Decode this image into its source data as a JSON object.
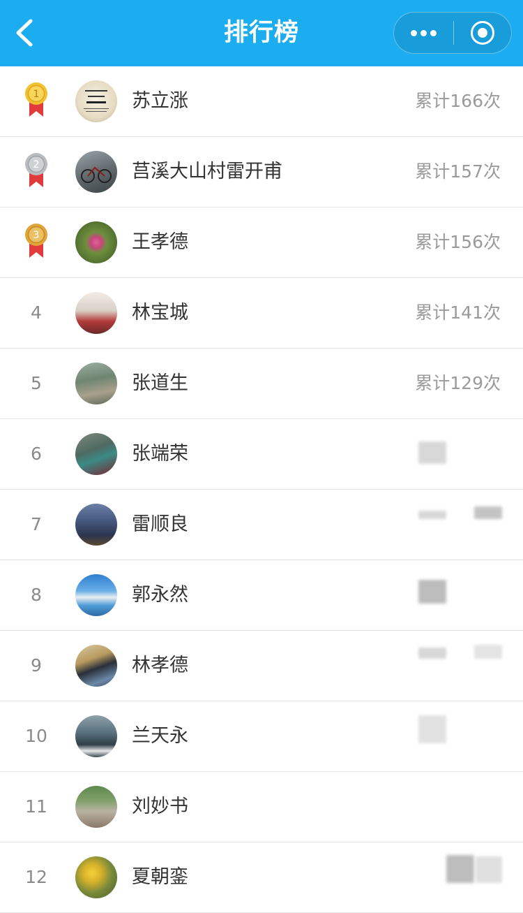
{
  "navbar": {
    "title": "排行榜",
    "back_icon": "chevron-left-icon",
    "more_icon": "more-dots-icon",
    "close_icon": "target-close-icon",
    "bg_color": "#1badf0"
  },
  "ranking": [
    {
      "rank": "1",
      "name": "苏立涨",
      "score": "累计166次",
      "medal": "gold"
    },
    {
      "rank": "2",
      "name": "莒溪大山村雷开甫",
      "score": "累计157次",
      "medal": "silver"
    },
    {
      "rank": "3",
      "name": "王孝德",
      "score": "累计156次",
      "medal": "bronze"
    },
    {
      "rank": "4",
      "name": "林宝城",
      "score": "累计141次"
    },
    {
      "rank": "5",
      "name": "张道生",
      "score": "累计129次"
    },
    {
      "rank": "6",
      "name": "张端荣",
      "score": ""
    },
    {
      "rank": "7",
      "name": "雷顺良",
      "score": ""
    },
    {
      "rank": "8",
      "name": "郭永然",
      "score": ""
    },
    {
      "rank": "9",
      "name": "林孝德",
      "score": ""
    },
    {
      "rank": "10",
      "name": "兰天永",
      "score": ""
    },
    {
      "rank": "11",
      "name": "刘妙书",
      "score": ""
    },
    {
      "rank": "12",
      "name": "夏朝銮",
      "score": ""
    }
  ],
  "colors": {
    "gold": "#f2c12e",
    "silver": "#b9bcc0",
    "bronze": "#e0a83c",
    "ribbon": "#e23b3b",
    "divider": "#e3e3e3"
  }
}
